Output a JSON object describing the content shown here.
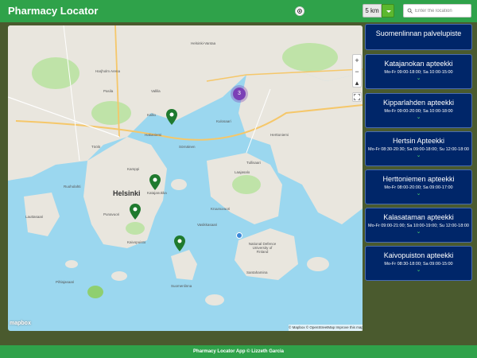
{
  "app": {
    "title": "Pharmacy Locator",
    "radius_value": "5 km",
    "search_placeholder": "Enter the location"
  },
  "map": {
    "city_label": "Helsinki",
    "labels": [
      "Harjholm Arena",
      "Suomenlinna",
      "Santahamina",
      "National Defence University of Finland",
      "Laajasalo",
      "Kulosaari",
      "Herttoniemi",
      "Kallio",
      "Töölö",
      "Kamppi",
      "Punavuori",
      "Kaivopuisto",
      "Ruoholahti",
      "Lauttasaari",
      "Katajanokka",
      "Hakaniemi",
      "Sörnäinen",
      "Vallila",
      "Pasila",
      "Tullisaari",
      "Kruunuvuori",
      "Vasikkasaari",
      "Pihlajasaari",
      "Helsinki-Vantaa"
    ],
    "cluster_count": "3",
    "attribution": "© Mapbox © OpenStreetMap Improve this map",
    "logo": "mapbox"
  },
  "pharmacies": [
    {
      "name": "Suomenlinnan palvelupiste",
      "hours": ""
    },
    {
      "name": "Katajanokan apteekki",
      "hours": "Mo-Fr 09:00-18:00; Sa 10:00-15:00"
    },
    {
      "name": "Kipparlahden apteekki",
      "hours": "Mo-Fr 09:00-20:00; Sa 10:00-18:00"
    },
    {
      "name": "Hertsin Apteekki",
      "hours": "Mo-Fr 08:30-20:30; Sa 09:00-18:00; Su 12:00-18:00"
    },
    {
      "name": "Herttoniemen apteekki",
      "hours": "Mo-Fr 08:00-20:00; Sa 09:00-17:00"
    },
    {
      "name": "Kalasataman apteekki",
      "hours": "Mo-Fr 09:00-21:00; Sa 10:00-19:00; Su 12:00-18:00"
    },
    {
      "name": "Kaivopuiston apteekki",
      "hours": "Mo-Fr 08:30-18:00; Sa 09:00-15:00"
    }
  ],
  "footer": {
    "text": "Pharmacy Locator App © Lizzeth Garcia"
  },
  "colors": {
    "header": "#2fa24a",
    "card": "#002669",
    "pin": "#1f7a2e",
    "cluster": "#7b3fb6"
  },
  "icons": [
    "locate-icon",
    "search-icon",
    "zoom-in-icon",
    "zoom-out-icon",
    "compass-icon",
    "fullscreen-icon",
    "map-pin-icon",
    "chevron-down-icon"
  ]
}
